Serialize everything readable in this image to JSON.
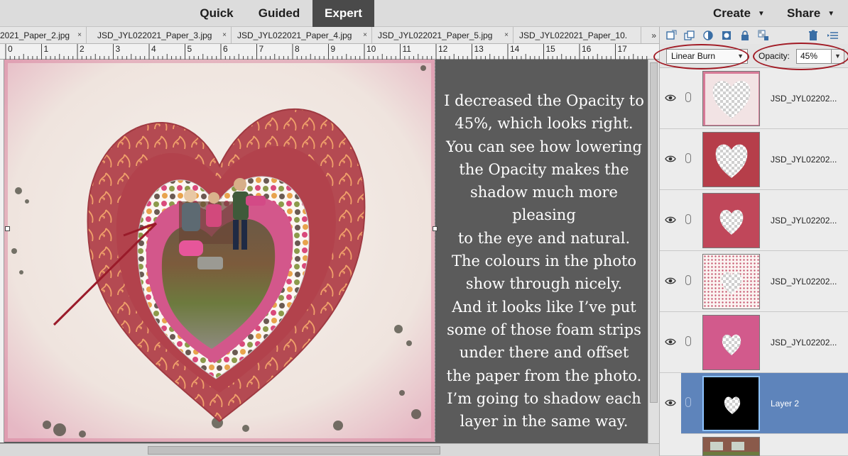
{
  "topbar": {
    "modes": [
      "Quick",
      "Guided",
      "Expert"
    ],
    "active_mode": "Expert",
    "create_label": "Create",
    "share_label": "Share"
  },
  "doc_tabs": [
    "2021_Paper_2.jpg",
    "JSD_JYL022021_Paper_3.jpg",
    "JSD_JYL022021_Paper_4.jpg",
    "JSD_JYL022021_Paper_5.jpg",
    "JSD_JYL022021_Paper_10."
  ],
  "tab_overflow": "»",
  "tab_close": "×",
  "ruler": {
    "labels": [
      "0",
      "1",
      "2",
      "3",
      "4",
      "5",
      "6",
      "7",
      "8",
      "9",
      "10",
      "11",
      "12",
      "13",
      "14",
      "15",
      "16",
      "17"
    ]
  },
  "caption": "I decreased the Opacity to\n45%, which looks right.\nYou can see how lowering\nthe Opacity makes the\nshadow much more pleasing\nto the eye and natural.\nThe colours in the photo\nshow through nicely.\nAnd it looks like I’ve put\nsome of those foam strips\nunder there and offset\nthe paper from the photo.\nI’m going to shadow each\nlayer in the same way.",
  "layers_panel": {
    "blend_mode": "Linear Burn",
    "opacity_label": "Opacity:",
    "opacity_value": "45%",
    "annotation_color": "#a11a24",
    "selected_color": "#5e84bb",
    "layers": [
      {
        "name": "JSD_JYL02202...",
        "thumb": "frame-paper",
        "selected": false
      },
      {
        "name": "JSD_JYL02202...",
        "thumb": "red-texture",
        "selected": false
      },
      {
        "name": "JSD_JYL02202...",
        "thumb": "red-damask",
        "selected": false
      },
      {
        "name": "JSD_JYL02202...",
        "thumb": "polka-dot",
        "selected": false
      },
      {
        "name": "JSD_JYL02202...",
        "thumb": "pink-paper",
        "selected": false
      },
      {
        "name": "Layer 2",
        "thumb": "black-shadow",
        "selected": true
      }
    ]
  }
}
